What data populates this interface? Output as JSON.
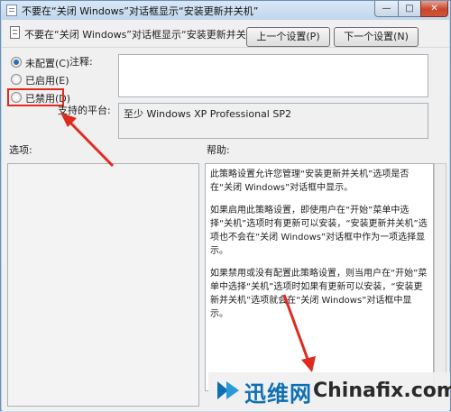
{
  "window": {
    "title": "不要在“关闭 Windows”对话框显示“安装更新并关机”",
    "minimize_glyph": "—",
    "maximize_glyph": "□",
    "close_glyph": "✕"
  },
  "header": {
    "policy_name": "不要在“关闭 Windows”对话框显示“安装更新并关机”",
    "prev_button": "上一个设置(P)",
    "next_button": "下一个设置(N)"
  },
  "state_options": [
    {
      "label": "未配置(C)",
      "checked": true
    },
    {
      "label": "已启用(E)",
      "checked": false
    },
    {
      "label": "已禁用(D)",
      "checked": false
    }
  ],
  "comment": {
    "label": "注释:",
    "value": ""
  },
  "supported": {
    "label": "支持的平台:",
    "value": "至少 Windows XP Professional SP2"
  },
  "options": {
    "label": "选项:"
  },
  "help": {
    "label": "帮助:",
    "paragraphs": [
      "此策略设置允许您管理“安装更新并关机”选项是否在“关闭 Windows”对话框中显示。",
      "如果启用此策略设置，即使用户在“开始”菜单中选择“关机”选项时有更新可以安装，“安装更新并关机”选项也不会在“关闭 Windows”对话框中作为一项选择显示。",
      "如果禁用或没有配置此策略设置，则当用户在“开始”菜单中选择“关机”选项时如果有更新可以安装，“安装更新并关机”选项就会在“关闭 Windows”对话框中显示。"
    ]
  },
  "watermark": {
    "cn": "迅维网",
    "en": "Chinafix.com"
  },
  "colors": {
    "annotation_red": "#e02a20",
    "brand_blue": "#0e6fb3"
  }
}
